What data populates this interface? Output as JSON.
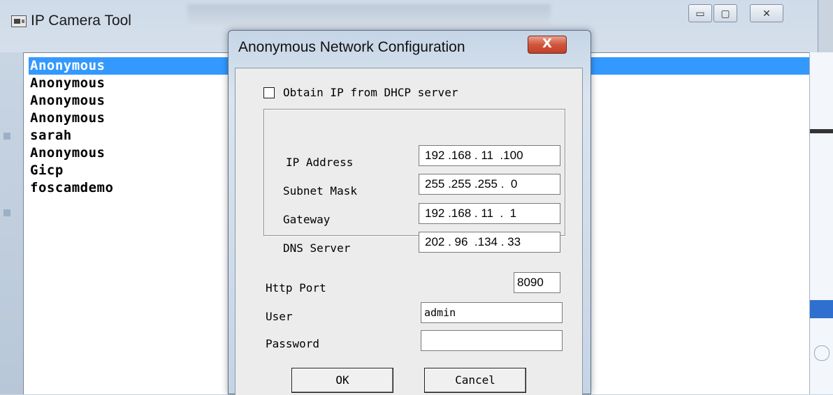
{
  "main_window": {
    "title": "IP Camera Tool",
    "controls": {
      "minimize": "▭",
      "maximize": "▢",
      "close": "✕"
    },
    "cameras": [
      {
        "name": "Anonymous",
        "selected": true
      },
      {
        "name": "Anonymous",
        "selected": false
      },
      {
        "name": "Anonymous",
        "selected": false
      },
      {
        "name": "Anonymous",
        "selected": false
      },
      {
        "name": "sarah",
        "selected": false
      },
      {
        "name": "Anonymous",
        "selected": false
      },
      {
        "name": "Gicp",
        "selected": false
      },
      {
        "name": "foscamdemo",
        "selected": false
      }
    ]
  },
  "dialog": {
    "title": "Anonymous Network Configuration",
    "close_symbol": "X",
    "dhcp": {
      "label": "Obtain IP from DHCP server",
      "checked": false
    },
    "ip_address": {
      "label": "IP Address",
      "value": "192 .168 . 11  .100"
    },
    "subnet_mask": {
      "label": "Subnet Mask",
      "value": "255 .255 .255 .  0"
    },
    "gateway": {
      "label": "Gateway",
      "value": "192 .168 . 11  .  1"
    },
    "dns_server": {
      "label": "DNS Server",
      "value": "202 . 96  .134 . 33"
    },
    "http_port": {
      "label": "Http Port",
      "value": "8090"
    },
    "user": {
      "label": "User",
      "value": "admin"
    },
    "password": {
      "label": "Password",
      "value": ""
    },
    "ok_label": "OK",
    "cancel_label": "Cancel"
  },
  "colors": {
    "selection": "#3399ff",
    "close_button": "#c8482f"
  }
}
